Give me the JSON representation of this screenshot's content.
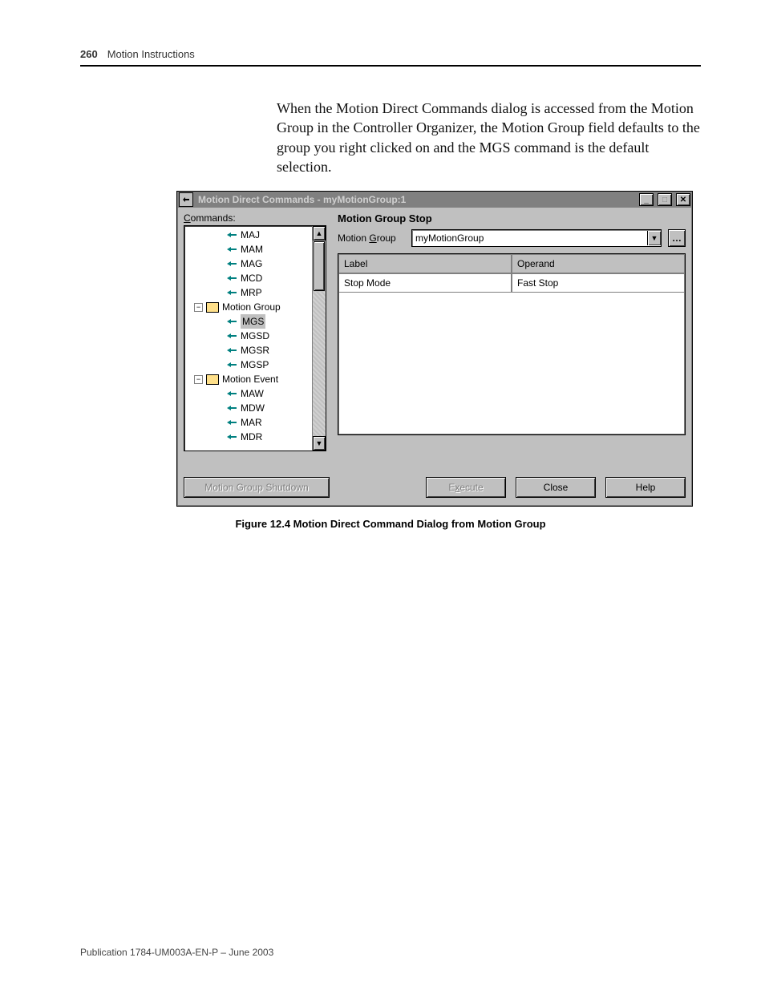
{
  "page": {
    "number": "260",
    "section": "Motion Instructions",
    "intro": "When the Motion Direct Commands dialog is accessed from the Motion Group in the Controller Organizer, the Motion Group field defaults to the group you right clicked on and the MGS command is the default selection.",
    "caption": "Figure 12.4 Motion Direct Command Dialog from Motion Group",
    "footer": "Publication 1784-UM003A-EN-P – June 2003"
  },
  "dialog": {
    "title": "Motion Direct Commands  - myMotionGroup:1",
    "commands_label_pre": "C",
    "commands_label_post": "ommands:",
    "tree": {
      "leaf_group_a": [
        "MAJ",
        "MAM",
        "MAG",
        "MCD",
        "MRP"
      ],
      "folder_group": "Motion Group",
      "group_children": [
        "MGS",
        "MGSD",
        "MGSR",
        "MGSP"
      ],
      "selected": "MGS",
      "folder_event": "Motion Event",
      "event_children": [
        "MAW",
        "MDW",
        "MAR",
        "MDR"
      ]
    },
    "right": {
      "title": "Motion Group Stop",
      "mg_label_pre": "Motion ",
      "mg_label_key": "G",
      "mg_label_post": "roup",
      "mg_value": "myMotionGroup",
      "grid_headers": [
        "Label",
        "Operand"
      ],
      "grid_row": [
        "Stop Mode",
        "Fast Stop"
      ]
    },
    "buttons": {
      "shutdown": "Motion Group Shutdown",
      "execute_pre": "E",
      "execute_key": "x",
      "execute_post": "ecute",
      "close": "Close",
      "help": "Help"
    }
  }
}
